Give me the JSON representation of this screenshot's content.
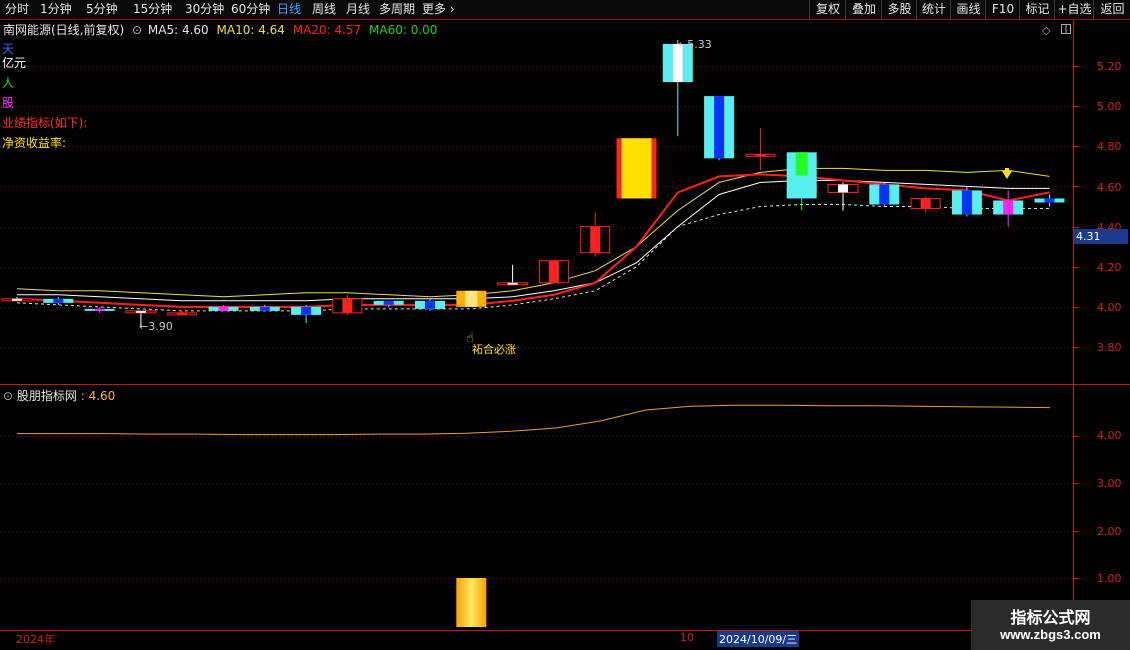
{
  "toolbar": {
    "tabs": [
      {
        "label": "分时",
        "active": false
      },
      {
        "label": "1分钟",
        "active": false
      },
      {
        "label": "5分钟",
        "active": false
      },
      {
        "label": "15分钟",
        "active": false
      },
      {
        "label": "30分钟",
        "active": false
      },
      {
        "label": "60分钟",
        "active": false
      },
      {
        "label": "日线",
        "active": true
      },
      {
        "label": "周线",
        "active": false
      },
      {
        "label": "月线",
        "active": false
      },
      {
        "label": "多周期",
        "active": false
      },
      {
        "label": "更多 ›",
        "active": false
      }
    ],
    "right_buttons": [
      "复权",
      "叠加",
      "多股",
      "统计",
      "画线",
      "F10",
      "标记",
      "+自选",
      "返回"
    ]
  },
  "main_header": {
    "title": "南网能源(日线,前复权)",
    "ma5": "MA5: 4.60",
    "ma10": "MA10: 4.64",
    "ma20": "MA20: 4.57",
    "ma60": "MA60: 0.00"
  },
  "left_labels": {
    "tian": "天",
    "yiyuan": "亿元",
    "ren": "人",
    "gu": "股",
    "perf": "业绩指标(如下):",
    "roe": "净资收益率:"
  },
  "annotations": {
    "high": "5.33",
    "low": "3.90",
    "signal": "祏合必涨"
  },
  "price_axis": [
    "5.20",
    "5.00",
    "4.80",
    "4.60",
    "4.40",
    "4.20",
    "4.00",
    "3.80"
  ],
  "current_price": "4.31",
  "sub_header": {
    "title": "股朋指标网",
    "value": ": 4.60"
  },
  "sub_axis": [
    "4.00",
    "3.00",
    "2.00",
    "1.00"
  ],
  "bottom": {
    "year": "2024年",
    "day": "10",
    "date": "2024/10/09/三"
  },
  "watermark": {
    "line1": "指标公式网",
    "line2": "www.zbgs3.com"
  },
  "colors": {
    "up": "#ff2020",
    "down_fill": "#56f0f0",
    "blue": "#0a32ff",
    "yellow": "#ffe000",
    "ma_white": "#ffffff",
    "ma_yellow": "#e6e04a",
    "ma_red": "#ff2020",
    "axis": "#c01818"
  },
  "chart_data": {
    "type": "candlestick",
    "price_range": [
      3.64,
      5.36
    ],
    "candles": [
      {
        "o": 4.04,
        "h": 4.05,
        "l": 4.03,
        "c": 4.04,
        "style": "white"
      },
      {
        "o": 4.04,
        "h": 4.05,
        "l": 4.01,
        "c": 4.02,
        "style": "cyan"
      },
      {
        "o": 3.99,
        "h": 4.0,
        "l": 3.97,
        "c": 3.98,
        "style": "magenta"
      },
      {
        "o": 3.98,
        "h": 3.98,
        "l": 3.9,
        "c": 3.97,
        "style": "white"
      },
      {
        "o": 3.97,
        "h": 3.98,
        "l": 3.96,
        "c": 3.97,
        "style": "red"
      },
      {
        "o": 4.0,
        "h": 4.01,
        "l": 3.98,
        "c": 3.98,
        "style": "magenta"
      },
      {
        "o": 4.0,
        "h": 4.01,
        "l": 3.98,
        "c": 3.98,
        "style": "cyan"
      },
      {
        "o": 4.0,
        "h": 4.01,
        "l": 3.92,
        "c": 3.96,
        "style": "cyan"
      },
      {
        "o": 3.97,
        "h": 4.06,
        "l": 3.96,
        "c": 4.04,
        "style": "red"
      },
      {
        "o": 4.03,
        "h": 4.03,
        "l": 4.0,
        "c": 4.01,
        "style": "cyan"
      },
      {
        "o": 4.03,
        "h": 4.04,
        "l": 3.98,
        "c": 3.99,
        "style": "cyan"
      },
      {
        "o": 4.0,
        "h": 4.08,
        "l": 4.0,
        "c": 4.08,
        "style": "gold"
      },
      {
        "o": 4.12,
        "h": 4.21,
        "l": 4.12,
        "c": 4.12,
        "style": "white"
      },
      {
        "o": 4.12,
        "h": 4.23,
        "l": 4.12,
        "c": 4.23,
        "style": "red"
      },
      {
        "o": 4.27,
        "h": 4.47,
        "l": 4.25,
        "c": 4.4,
        "style": "red"
      },
      {
        "o": 4.54,
        "h": 4.84,
        "l": 4.54,
        "c": 4.84,
        "style": "yellow"
      },
      {
        "o": 5.31,
        "h": 5.33,
        "l": 4.85,
        "c": 5.12,
        "style": "cyan"
      },
      {
        "o": 5.05,
        "h": 5.05,
        "l": 4.73,
        "c": 4.74,
        "style": "cyan"
      },
      {
        "o": 4.76,
        "h": 4.89,
        "l": 4.68,
        "c": 4.75,
        "style": "red"
      },
      {
        "o": 4.77,
        "h": 4.77,
        "l": 4.48,
        "c": 4.54,
        "style": "green"
      },
      {
        "o": 4.61,
        "h": 4.62,
        "l": 4.48,
        "c": 4.57,
        "style": "white"
      },
      {
        "o": 4.61,
        "h": 4.62,
        "l": 4.5,
        "c": 4.51,
        "style": "cyan"
      },
      {
        "o": 4.54,
        "h": 4.55,
        "l": 4.47,
        "c": 4.49,
        "style": "red"
      },
      {
        "o": 4.58,
        "h": 4.6,
        "l": 4.45,
        "c": 4.46,
        "style": "cyan"
      },
      {
        "o": 4.53,
        "h": 4.58,
        "l": 4.4,
        "c": 4.46,
        "style": "magenta"
      },
      {
        "o": 4.54,
        "h": 4.56,
        "l": 4.5,
        "c": 4.52,
        "style": "cyan"
      }
    ],
    "ma_yellow": [
      4.09,
      4.08,
      4.08,
      4.07,
      4.06,
      4.05,
      4.06,
      4.07,
      4.07,
      4.06,
      4.05,
      4.06,
      4.08,
      4.12,
      4.18,
      4.3,
      4.48,
      4.62,
      4.67,
      4.69,
      4.69,
      4.68,
      4.68,
      4.67,
      4.68,
      4.65
    ],
    "ma_white": [
      4.06,
      4.06,
      4.05,
      4.04,
      4.03,
      4.03,
      4.03,
      4.03,
      4.04,
      4.04,
      4.04,
      4.04,
      4.05,
      4.08,
      4.12,
      4.22,
      4.4,
      4.56,
      4.62,
      4.63,
      4.63,
      4.62,
      4.61,
      4.6,
      4.59,
      4.59
    ],
    "ma_red": [
      4.04,
      4.03,
      4.02,
      4.01,
      4.0,
      4.0,
      4.0,
      4.0,
      4.01,
      4.01,
      4.01,
      4.01,
      4.03,
      4.06,
      4.12,
      4.3,
      4.57,
      4.65,
      4.66,
      4.65,
      4.63,
      4.61,
      4.59,
      4.58,
      4.53,
      4.57
    ],
    "ma_dashed": [
      4.02,
      4.01,
      4.0,
      3.99,
      3.98,
      3.98,
      3.98,
      3.98,
      3.99,
      3.99,
      3.99,
      3.99,
      4.01,
      4.04,
      4.08,
      4.2,
      4.4,
      4.46,
      4.5,
      4.51,
      4.51,
      4.5,
      4.5,
      4.49,
      4.49,
      4.49
    ],
    "sub_line": [
      4.05,
      4.05,
      4.05,
      4.04,
      4.04,
      4.03,
      4.03,
      4.03,
      4.04,
      4.04,
      4.06,
      4.1,
      4.17,
      4.32,
      4.55,
      4.63,
      4.65,
      4.65,
      4.64,
      4.64,
      4.63,
      4.62,
      4.61,
      4.6
    ],
    "sub_range": [
      0.0,
      5.0
    ],
    "sub_bar": {
      "index": 11,
      "value": 1.0
    }
  }
}
